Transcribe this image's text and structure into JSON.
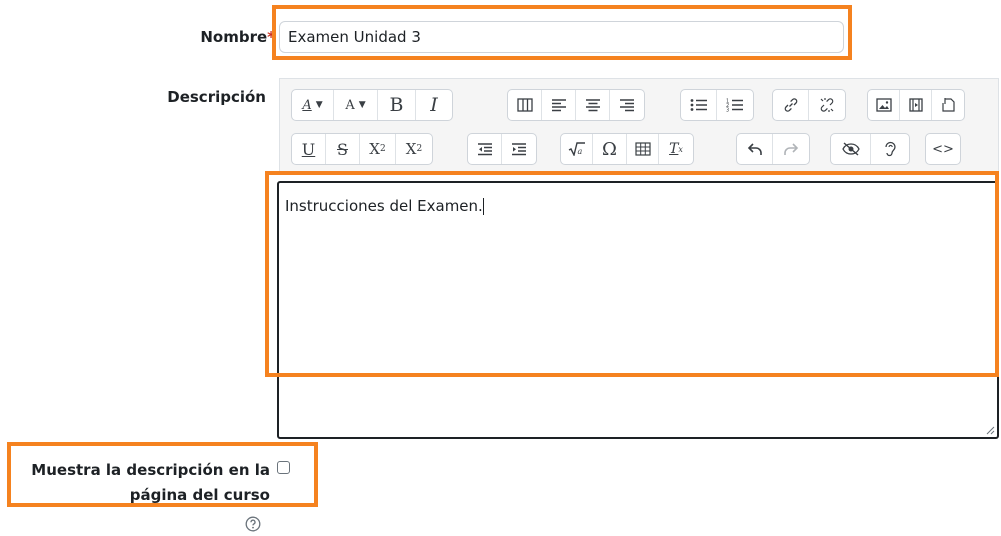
{
  "form": {
    "name_label": "Nombre",
    "required_mark": "*",
    "name_value": "Examen Unidad 3",
    "description_label": "Descripción",
    "description_text": "Instrucciones del Examen.",
    "show_description_line1": "Muestra la descripción en la",
    "show_description_line2": "página del curso",
    "show_description_checked": false
  },
  "toolbar": {
    "row1": {
      "text_style": "A",
      "text_size": "A",
      "bold": "B",
      "italic": "I"
    },
    "row2": {
      "underline": "U",
      "strikethrough": "S",
      "subscript": "X",
      "subscript_mark": "2",
      "superscript": "X",
      "superscript_mark": "2",
      "omega": "Ω",
      "clear_format": "T",
      "clear_format_mark": "x",
      "html": "<>"
    }
  },
  "colors": {
    "highlight": "#f5821f",
    "required": "#ca3120"
  }
}
